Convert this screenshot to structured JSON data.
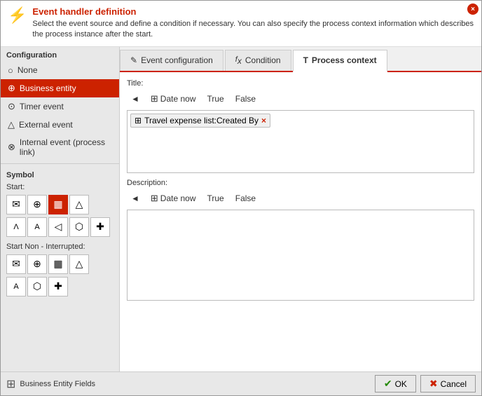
{
  "header": {
    "title": "Event handler definition",
    "description": "Select the event source and define a condition if necessary. You can also specify the process context information which describes the process instance after the start.",
    "close_label": "×"
  },
  "sidebar": {
    "configuration_label": "Configuration",
    "items": [
      {
        "id": "none",
        "label": "None",
        "icon": "○",
        "active": false
      },
      {
        "id": "business-entity",
        "label": "Business entity",
        "icon": "⊕",
        "active": true
      },
      {
        "id": "timer-event",
        "label": "Timer event",
        "icon": "⊙",
        "active": false
      },
      {
        "id": "external-event",
        "label": "External event",
        "icon": "△",
        "active": false
      },
      {
        "id": "internal-event",
        "label": "Internal event (process link)",
        "icon": "⊗",
        "active": false
      }
    ],
    "symbol_label": "Symbol",
    "start_label": "Start:",
    "start_non_interrupted_label": "Start Non - Interrupted:",
    "start_symbols": [
      "✉",
      "⊕",
      "▦",
      "△"
    ],
    "start_symbols_row2": [
      "Λ",
      "A",
      "◁",
      "⬡",
      "✚"
    ],
    "start_ni_symbols": [
      "✉",
      "⊕",
      "▦",
      "△"
    ],
    "start_ni_symbols_row2": [
      "A",
      "⬡",
      "✚"
    ]
  },
  "tabs": [
    {
      "id": "event-config",
      "label": "Event configuration",
      "icon": "✎",
      "active": false
    },
    {
      "id": "condition",
      "label": "Condition",
      "icon": "fx",
      "active": false
    },
    {
      "id": "process-context",
      "label": "Process context",
      "icon": "T",
      "active": true
    }
  ],
  "process_context": {
    "title_label": "Title:",
    "title_toolbar": {
      "arrow": "◄",
      "date_now": "Date now",
      "true_label": "True",
      "false_label": "False"
    },
    "title_tag": "Travel expense list:Created By",
    "description_label": "Description:",
    "description_toolbar": {
      "arrow": "◄",
      "date_now": "Date now",
      "true_label": "True",
      "false_label": "False"
    }
  },
  "footer": {
    "icon": "⊞",
    "label": "Business Entity Fields",
    "ok_label": "OK",
    "cancel_label": "Cancel",
    "ok_check": "✔",
    "cancel_x": "✖"
  }
}
